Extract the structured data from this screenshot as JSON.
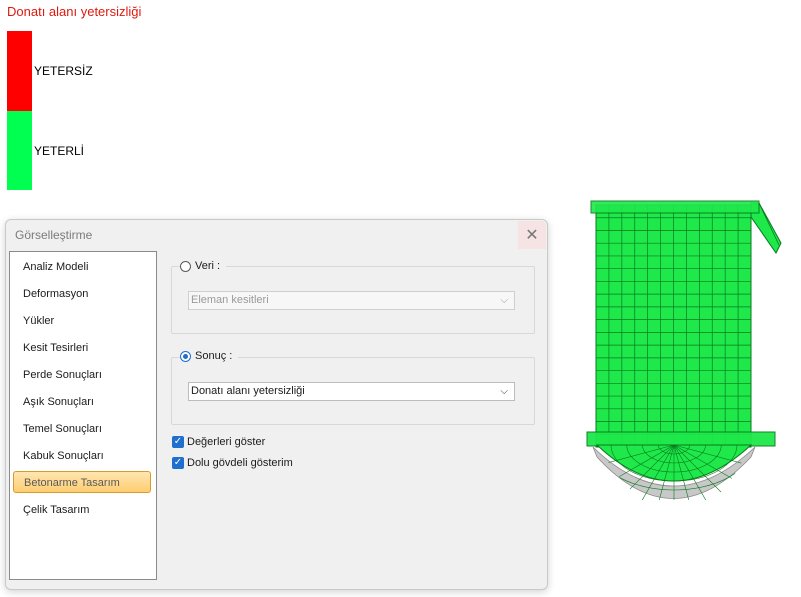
{
  "legend": {
    "title": "Donatı alanı yetersizliği",
    "items": [
      {
        "label": "YETERSİZ",
        "color": "#ff0000"
      },
      {
        "label": "YETERLİ",
        "color": "#00ff50"
      }
    ]
  },
  "dialog": {
    "title": "Görselleştirme",
    "close_icon": "close-icon",
    "nav": [
      {
        "label": "Analiz Modeli"
      },
      {
        "label": "Deformasyon"
      },
      {
        "label": "Yükler"
      },
      {
        "label": "Kesit Tesirleri"
      },
      {
        "label": "Perde Sonuçları"
      },
      {
        "label": "Aşık Sonuçları"
      },
      {
        "label": "Temel Sonuçları"
      },
      {
        "label": "Kabuk Sonuçları"
      },
      {
        "label": "Betonarme Tasarım",
        "selected": true
      },
      {
        "label": "Çelik Tasarım"
      }
    ],
    "veri": {
      "label": "Veri :",
      "checked": false,
      "combo_value": "Eleman kesitleri",
      "enabled": false
    },
    "sonuc": {
      "label": "Sonuç :",
      "checked": true,
      "combo_value": "Donatı alanı yetersizliği",
      "enabled": true
    },
    "options": [
      {
        "label": "Değerleri göster",
        "checked": true
      },
      {
        "label": "Dolu gövdeli gösterim",
        "checked": true
      }
    ]
  },
  "colors": {
    "accent": "#1f6fcf",
    "selected_nav": "#ffcd72",
    "model_green": "#1ee84a",
    "model_dark": "#0a7a1e"
  }
}
